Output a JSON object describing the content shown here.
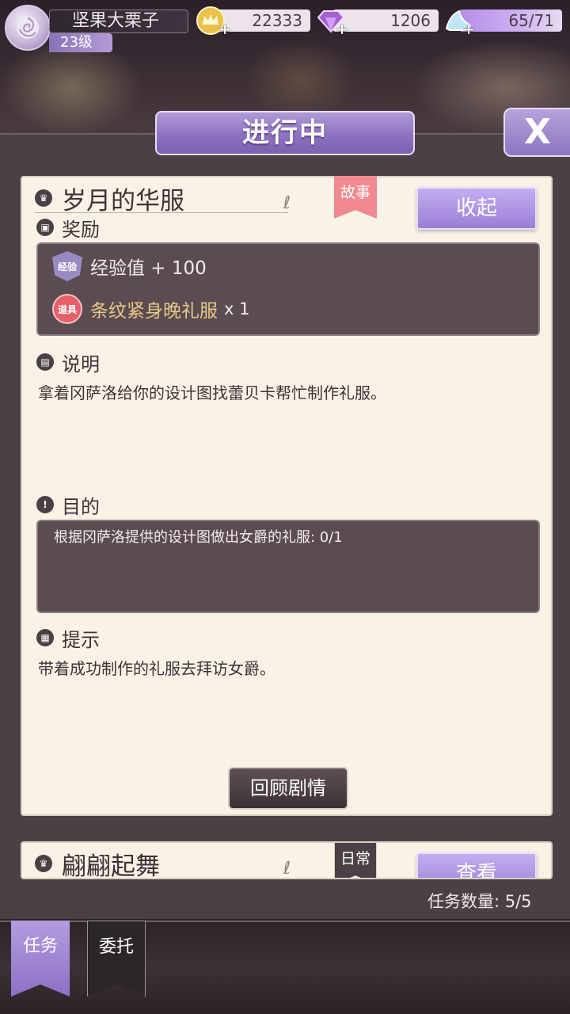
{
  "player": {
    "name": "坚果大栗子",
    "level": "23级"
  },
  "resources": {
    "gold": "22333",
    "diamond": "1206",
    "stamina": "65/71",
    "plus": "+"
  },
  "panel": {
    "title": "进行中",
    "close": "X"
  },
  "quests": [
    {
      "title": "岁月的华服",
      "tag": "故事",
      "button": "收起",
      "reward_label": "奖励",
      "rewards": [
        {
          "badge": "经验",
          "name": "经验值 + 100",
          "qty": ""
        },
        {
          "badge": "道具",
          "name": "条纹紧身晚礼服",
          "qty": "x 1"
        }
      ],
      "desc_label": "说明",
      "desc": "拿着冈萨洛给你的设计图找蕾贝卡帮忙制作礼服。",
      "goal_label": "目的",
      "goal": "根据冈萨洛提供的设计图做出女爵的礼服: 0/1",
      "hint_label": "提示",
      "hint": "带着成功制作的礼服去拜访女爵。",
      "review": "回顾剧情"
    },
    {
      "title": "翩翩起舞",
      "tag": "日常",
      "button": "查看"
    }
  ],
  "task_count": "任务数量:  5/5",
  "tabs": [
    {
      "label": "任务",
      "active": true
    },
    {
      "label": "委托",
      "active": false
    }
  ],
  "colors": {
    "accent_purple": "#9a7fd6",
    "card_bg": "#f8f3e6",
    "story_tag": "#f08a8f",
    "reward_gold": "#e8c888"
  }
}
